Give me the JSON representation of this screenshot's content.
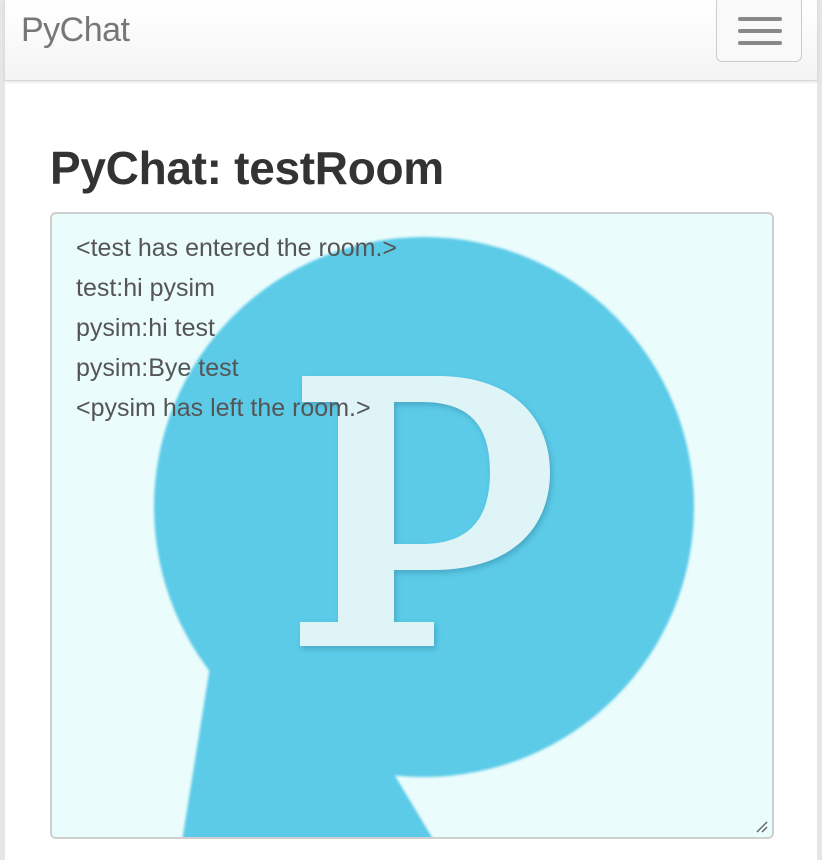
{
  "navbar": {
    "brand": "PyChat",
    "menu_toggle_icon": "hamburger-menu-icon"
  },
  "room": {
    "title": "PyChat: testRoom"
  },
  "chat": {
    "background_logo_icon": "pychat-logo-icon",
    "messages": [
      "<test has entered the room.>",
      "test:hi pysim",
      "pysim:hi test",
      "pysim:Bye test",
      "<pysim has left the room.>"
    ]
  },
  "colors": {
    "logo_bubble": "#5bcbe8",
    "logo_letter": "#dff4f6",
    "chat_background": "#eafcfc"
  }
}
